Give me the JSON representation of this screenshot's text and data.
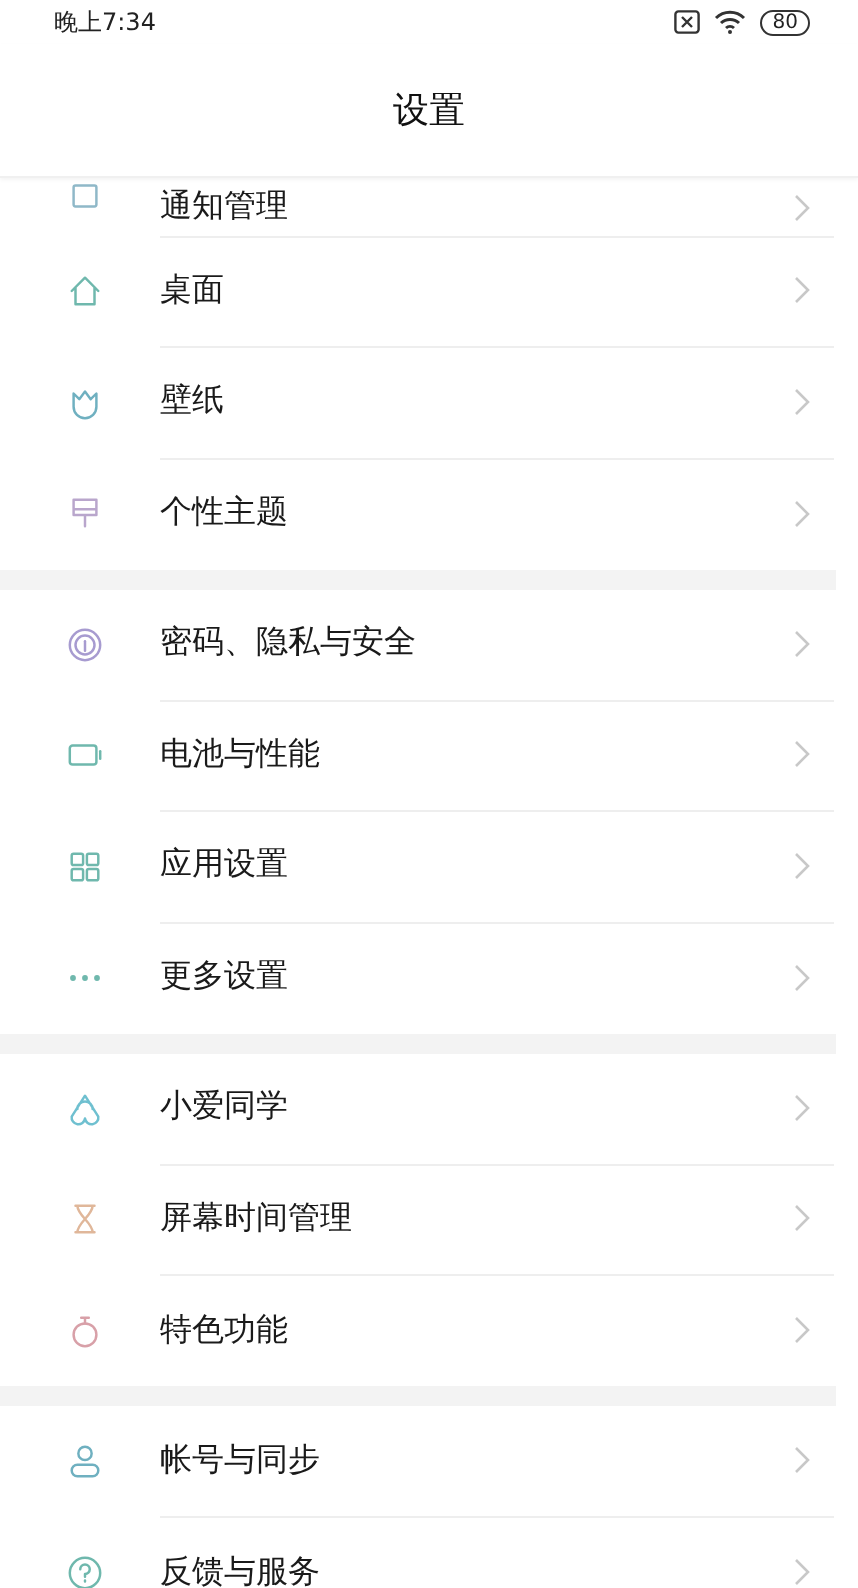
{
  "status_bar": {
    "time": "晚上7:34",
    "battery": "80"
  },
  "title": "设置",
  "sections": [
    [
      {
        "label": "通知管理"
      },
      {
        "label": "桌面"
      },
      {
        "label": "壁纸"
      },
      {
        "label": "个性主题"
      }
    ],
    [
      {
        "label": "密码、隐私与安全"
      },
      {
        "label": "电池与性能"
      },
      {
        "label": "应用设置"
      },
      {
        "label": "更多设置"
      }
    ],
    [
      {
        "label": "小爱同学"
      },
      {
        "label": "屏幕时间管理"
      },
      {
        "label": "特色功能"
      }
    ],
    [
      {
        "label": "帐号与同步"
      },
      {
        "label": "反馈与服务"
      }
    ]
  ]
}
